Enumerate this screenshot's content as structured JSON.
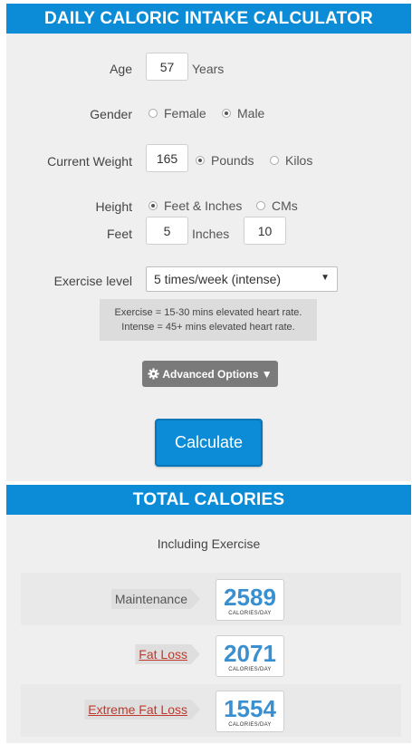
{
  "header": {
    "title": "DAILY CALORIC INTAKE CALCULATOR"
  },
  "form": {
    "age": {
      "label": "Age",
      "value": "57",
      "unit": "Years"
    },
    "gender": {
      "label": "Gender",
      "options": [
        "Female",
        "Male"
      ],
      "selected": "Male"
    },
    "weight": {
      "label": "Current Weight",
      "value": "165",
      "options": [
        "Pounds",
        "Kilos"
      ],
      "selected": "Pounds"
    },
    "height": {
      "label": "Height",
      "options": [
        "Feet & Inches",
        "CMs"
      ],
      "selected": "Feet & Inches",
      "feet_label": "Feet",
      "feet_value": "5",
      "inches_label": "Inches",
      "inches_value": "10"
    },
    "exercise": {
      "label": "Exercise level",
      "selected": "5 times/week (intense)",
      "note_line1": "Exercise = 15-30 mins elevated heart rate.",
      "note_line2": "Intense = 45+ mins elevated heart rate."
    },
    "advanced_label": "Advanced Options ▼",
    "calculate_label": "Calculate"
  },
  "results": {
    "title": "TOTAL CALORIES",
    "subtitle": "Including Exercise",
    "unit": "CALORIES/DAY",
    "rows": [
      {
        "label": "Maintenance",
        "value": "2589"
      },
      {
        "label": "Fat Loss",
        "value": "2071"
      },
      {
        "label": "Extreme Fat Loss",
        "value": "1554"
      }
    ]
  },
  "colors": {
    "accent": "#0c8bd6",
    "value": "#3a8fd0",
    "link": "#c0392b"
  }
}
